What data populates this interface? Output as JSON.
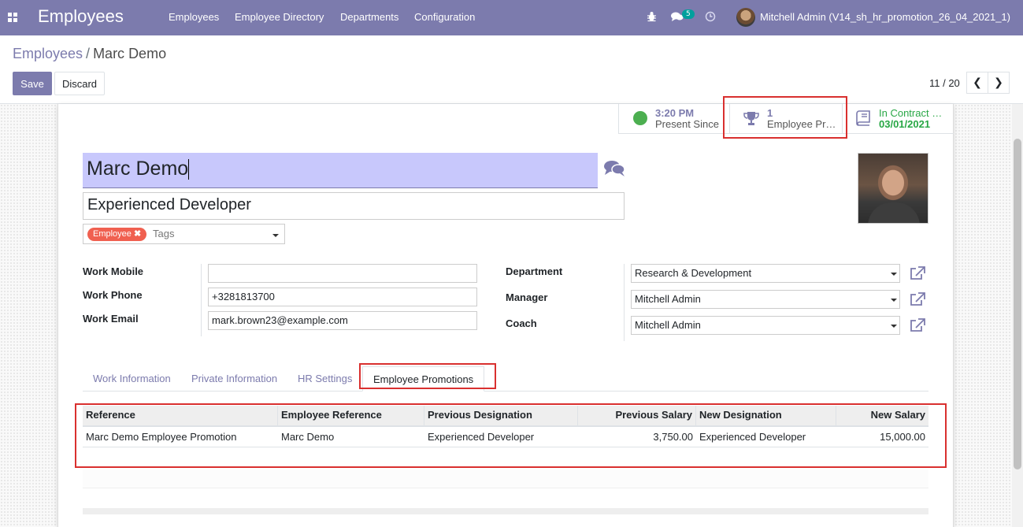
{
  "navbar": {
    "app_title": "Employees",
    "menu": [
      "Employees",
      "Employee Directory",
      "Departments",
      "Configuration"
    ],
    "messages_count": "5",
    "user": "Mitchell Admin (V14_sh_hr_promotion_26_04_2021_1)"
  },
  "breadcrumb": {
    "parent": "Employees",
    "separator": "/",
    "current": "Marc Demo"
  },
  "toolbar": {
    "save_label": "Save",
    "discard_label": "Discard"
  },
  "pager": {
    "value": "11 / 20",
    "prev": "❮",
    "next": "❯"
  },
  "smart_buttons": {
    "presence_value": "3:20 PM",
    "presence_label": "Present Since",
    "promotions_count": "1",
    "promotions_label": "Employee Pr…",
    "contract_value": "In Contract …",
    "contract_date": "03/01/2021"
  },
  "employee": {
    "name": "Marc Demo",
    "job_title": "Experienced Developer",
    "tag": "Employee",
    "tags_placeholder": "Tags"
  },
  "fields_left": {
    "work_mobile_label": "Work Mobile",
    "work_mobile_value": "",
    "work_phone_label": "Work Phone",
    "work_phone_value": "+3281813700",
    "work_email_label": "Work Email",
    "work_email_value": "mark.brown23@example.com"
  },
  "fields_right": {
    "department_label": "Department",
    "department_value": "Research & Development",
    "manager_label": "Manager",
    "manager_value": "Mitchell Admin",
    "coach_label": "Coach",
    "coach_value": "Mitchell Admin"
  },
  "tabs": [
    "Work Information",
    "Private Information",
    "HR Settings",
    "Employee Promotions"
  ],
  "promotions_table": {
    "headers": [
      "Reference",
      "Employee Reference",
      "Previous Designation",
      "Previous Salary",
      "New Designation",
      "New Salary"
    ],
    "rows": [
      [
        "Marc Demo Employee Promotion",
        "Marc Demo",
        "Experienced Developer",
        "3,750.00",
        "Experienced Developer",
        "15,000.00"
      ]
    ]
  },
  "colors": {
    "brand": "#7c7bad",
    "highlight": "#d9302f",
    "present": "#4caf50",
    "contract": "#28a745",
    "tag": "#f06050"
  }
}
